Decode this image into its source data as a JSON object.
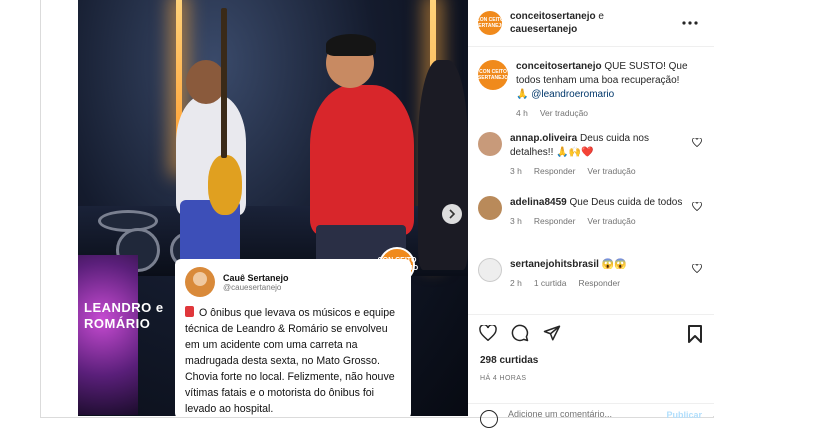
{
  "post": {
    "authors": {
      "primary": "conceitosertanejo",
      "connector": "e",
      "secondary": "cauesertanejo"
    },
    "avatar_text": "CON CEITO SERTANEJO",
    "more_icon": "more-horizontal-icon"
  },
  "media": {
    "led_screen_text": "LEANDRO e ROMÁRIO",
    "watermark_logo": "CON CEITO SERTANEJO",
    "next_icon": "chevron-right-icon",
    "tweet": {
      "name": "Cauê Sertanejo",
      "handle": "@cauesertanejo",
      "body": "O ônibus que levava os músicos e equipe técnica de Leandro & Romário se envolveu em um acidente com uma carreta na madrugada desta sexta, no Mato Grosso. Chovia forte no local. Felizmente, não houve vítimas fatais e o motorista do ônibus foi levado ao hospital."
    }
  },
  "caption": {
    "user": "conceitosertanejo",
    "text": "QUE SUSTO! Que todos tenham uma boa recuperação! 🙏",
    "mention": "@leandroeromario",
    "time": "4 h",
    "translate": "Ver tradução"
  },
  "comments": [
    {
      "user": "annap.oliveira",
      "text": "Deus cuida nos detalhes!! 🙏🙌❤️",
      "time": "3 h",
      "reply": "Responder",
      "translate": "Ver tradução"
    },
    {
      "user": "adelina8459",
      "text": "Que Deus cuida de todos",
      "time": "3 h",
      "reply": "Responder",
      "translate": "Ver tradução"
    },
    {
      "user": "sertanejohitsbrasil",
      "text": "😱😱",
      "time": "2 h",
      "likes": "1 curtida",
      "reply": "Responder"
    }
  ],
  "actions": {
    "likes": "298 curtidas",
    "posted": "HÁ 4 HORAS",
    "comment_placeholder": "Adicione um comentário...",
    "post_button": "Publicar"
  },
  "colors": {
    "brand_orange": "#f08a1c",
    "link": "#00376b",
    "muted": "#737373",
    "post_disabled": "#b2dffc"
  }
}
